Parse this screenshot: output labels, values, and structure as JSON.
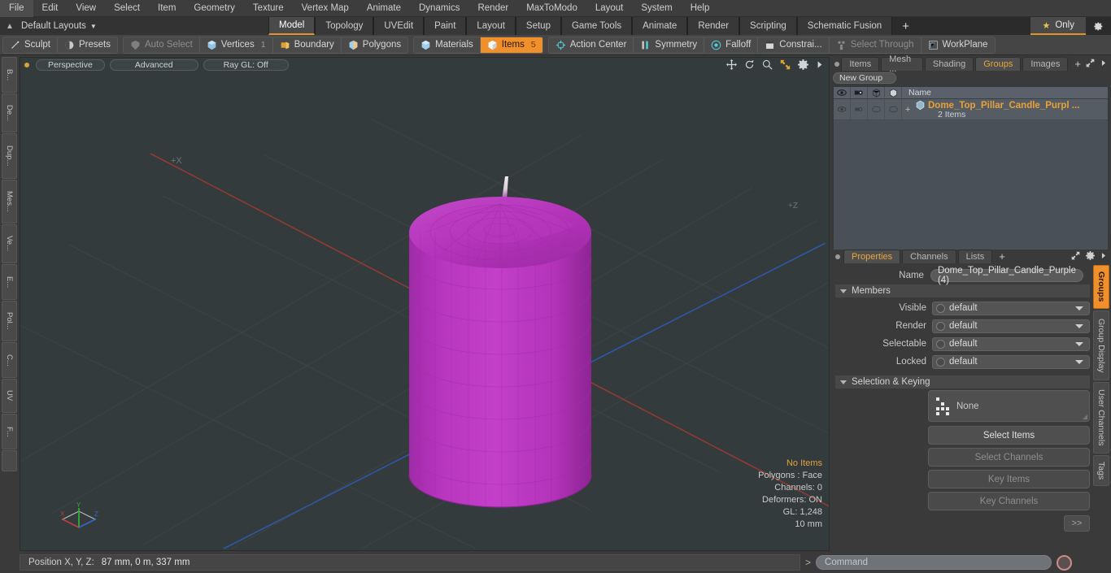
{
  "menu": {
    "items": [
      "File",
      "Edit",
      "View",
      "Select",
      "Item",
      "Geometry",
      "Texture",
      "Vertex Map",
      "Animate",
      "Dynamics",
      "Render",
      "MaxToModo",
      "Layout",
      "System",
      "Help"
    ]
  },
  "layout_bar": {
    "layouts_label": "Default Layouts",
    "tabs": [
      {
        "label": "Model",
        "active": true
      },
      {
        "label": "Topology",
        "active": false
      },
      {
        "label": "UVEdit",
        "active": false
      },
      {
        "label": "Paint",
        "active": false
      },
      {
        "label": "Layout",
        "active": false
      },
      {
        "label": "Setup",
        "active": false
      },
      {
        "label": "Game Tools",
        "active": false
      },
      {
        "label": "Animate",
        "active": false
      },
      {
        "label": "Render",
        "active": false
      },
      {
        "label": "Scripting",
        "active": false
      },
      {
        "label": "Schematic Fusion",
        "active": false
      }
    ],
    "add_tab_label": "+",
    "only_label": "Only",
    "gear_icon": "gear-icon",
    "star_icon": "star-icon"
  },
  "toolbar": {
    "groups": [
      {
        "buttons": [
          {
            "label": "Sculpt",
            "icon": "sculpt-icon",
            "state": "normal",
            "count": ""
          },
          {
            "label": "Presets",
            "icon": "presets-icon",
            "state": "normal",
            "count": ""
          }
        ]
      },
      {
        "buttons": [
          {
            "label": "Auto Select",
            "icon": "auto-select-icon",
            "state": "dim",
            "count": ""
          },
          {
            "label": "Vertices",
            "icon": "vertices-icon",
            "state": "normal",
            "count": "1"
          },
          {
            "label": "Boundary",
            "icon": "boundary-icon",
            "state": "normal",
            "count": ""
          },
          {
            "label": "Polygons",
            "icon": "polygons-icon",
            "state": "normal",
            "count": ""
          }
        ]
      },
      {
        "buttons": [
          {
            "label": "Materials",
            "icon": "materials-icon",
            "state": "normal",
            "count": ""
          },
          {
            "label": "Items",
            "icon": "items-icon",
            "state": "selected",
            "count": "5"
          }
        ]
      },
      {
        "buttons": [
          {
            "label": "Action Center",
            "icon": "action-center-icon",
            "state": "normal",
            "count": ""
          },
          {
            "label": "Symmetry",
            "icon": "symmetry-icon",
            "state": "normal",
            "count": ""
          },
          {
            "label": "Falloff",
            "icon": "falloff-icon",
            "state": "normal",
            "count": ""
          },
          {
            "label": "Constrai...",
            "icon": "constraint-icon",
            "state": "normal",
            "count": ""
          },
          {
            "label": "Select Through",
            "icon": "select-through-icon",
            "state": "dim",
            "count": ""
          },
          {
            "label": "WorkPlane",
            "icon": "workplane-icon",
            "state": "normal",
            "count": ""
          }
        ]
      }
    ]
  },
  "left_strip": {
    "tabs": [
      "B...",
      "De...",
      "Dup...",
      "Mes...",
      "Ve...",
      "E...",
      "Pol...",
      "C...",
      "UV",
      "F..."
    ]
  },
  "viewport": {
    "view_label": "Perspective",
    "shading_label": "Advanced",
    "raygl_label": "Ray GL: Off",
    "axis_label_x": "+X",
    "icons": [
      "move-icon",
      "rotate-icon",
      "zoom-icon",
      "fit-icon",
      "gear-icon",
      "arrow-right-icon"
    ],
    "stats": {
      "selection": "No Items",
      "polygons": "Polygons : Face",
      "channels": "Channels: 0",
      "deformers": "Deformers: ON",
      "gl": "GL: 1,248",
      "grid": "10 mm"
    },
    "gizmo": {
      "x": "X",
      "y": "Y",
      "z": "Z"
    },
    "model": {
      "name": "Dome Top Pillar Candle Purple",
      "body_color": "#b838bd",
      "body_shadow": "#9a2fa3",
      "wick_color": "#e8e0e6",
      "background_color": "#343b3c"
    }
  },
  "right_panel": {
    "tabs": [
      {
        "label": "Items",
        "active": false
      },
      {
        "label": "Mesh ...",
        "active": false
      },
      {
        "label": "Shading",
        "active": false
      },
      {
        "label": "Groups",
        "active": true
      },
      {
        "label": "Images",
        "active": false
      }
    ],
    "add_tab_label": "+",
    "new_group_label": "New Group",
    "tree": {
      "columns": [
        "eye-icon",
        "render-icon",
        "wireframe-icon",
        "shade-icon"
      ],
      "name_header": "Name",
      "rows": [
        {
          "name": "Dome_Top_Pillar_Candle_Purpl  ...",
          "subtitle": "2 Items",
          "expander": "+"
        }
      ]
    }
  },
  "properties": {
    "tabs": [
      {
        "label": "Properties",
        "active": true
      },
      {
        "label": "Channels",
        "active": false
      },
      {
        "label": "Lists",
        "active": false
      }
    ],
    "add_tab_label": "+",
    "name_label": "Name",
    "name_value": "Dome_Top_Pillar_Candle_Purple (4)",
    "members_section": "Members",
    "members": [
      {
        "label": "Visible",
        "value": "default"
      },
      {
        "label": "Render",
        "value": "default"
      },
      {
        "label": "Selectable",
        "value": "default"
      },
      {
        "label": "Locked",
        "value": "default"
      }
    ],
    "selection_section": "Selection & Keying",
    "selection_set": "None",
    "buttons": [
      {
        "label": "Select Items",
        "enabled": true
      },
      {
        "label": "Select Channels",
        "enabled": false
      },
      {
        "label": "Key Items",
        "enabled": false
      },
      {
        "label": "Key Channels",
        "enabled": false
      }
    ],
    "more_label": ">>"
  },
  "right_strip": {
    "tabs": [
      {
        "label": "Groups",
        "active": true
      },
      {
        "label": "Group Display",
        "active": false
      },
      {
        "label": "User Channels",
        "active": false
      },
      {
        "label": "Tags",
        "active": false
      }
    ]
  },
  "status_bar": {
    "position_label": "Position X, Y, Z:",
    "position_value": "87 mm, 0 m, 337 mm",
    "prompt": ">",
    "command_placeholder": "Command",
    "record_icon": "record-icon"
  },
  "colors": {
    "accent_orange": "#f0902c",
    "tab_orange": "#e8a73c",
    "panel_bg": "#3a3a3a",
    "viewport_bg": "#343b3c"
  }
}
